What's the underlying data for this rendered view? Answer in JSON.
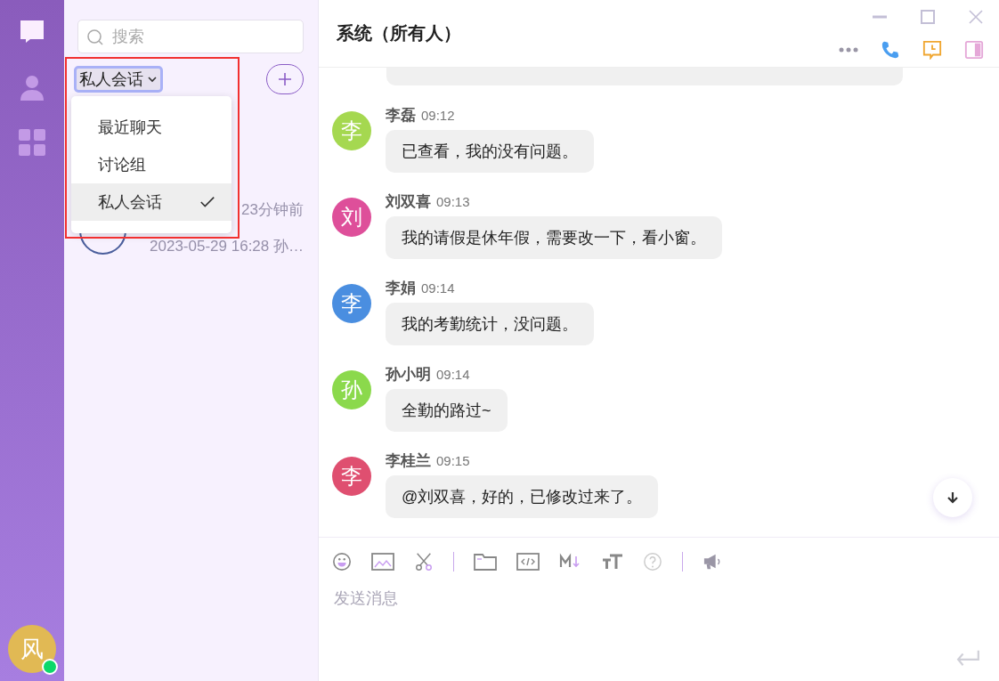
{
  "sidebar": {
    "user_avatar": {
      "initial": "风",
      "online": true
    }
  },
  "conversation_list": {
    "search": {
      "placeholder": "搜索"
    },
    "filter": {
      "label": "私人会话"
    },
    "items": [
      {
        "time": "23分钟前",
        "preview": "2023-05-29 16:28 孙…"
      }
    ]
  },
  "filter_menu": {
    "items": [
      {
        "label": "最近聊天",
        "selected": false
      },
      {
        "label": "讨论组",
        "selected": false
      },
      {
        "label": "私人会话",
        "selected": true
      }
    ]
  },
  "chat": {
    "title": "系统（所有人）",
    "messages": [
      {
        "initial": "李",
        "color": "#a5d850",
        "name": "李磊",
        "time": "09:12",
        "text": "已查看，我的没有问题。"
      },
      {
        "initial": "刘",
        "color": "#de4f9a",
        "name": "刘双喜",
        "time": "09:13",
        "text": "我的请假是休年假，需要改一下，看小窗。"
      },
      {
        "initial": "李",
        "color": "#4a8ee0",
        "name": "李娟",
        "time": "09:14",
        "text": "我的考勤统计，没问题。"
      },
      {
        "initial": "孙",
        "color": "#8bd94c",
        "name": "孙小明",
        "time": "09:14",
        "text": "全勤的路过~"
      },
      {
        "initial": "李",
        "color": "#df4f70",
        "name": "李桂兰",
        "time": "09:15",
        "text": "@刘双喜，好的，已修改过来了。"
      }
    ],
    "composer": {
      "placeholder": "发送消息"
    }
  }
}
